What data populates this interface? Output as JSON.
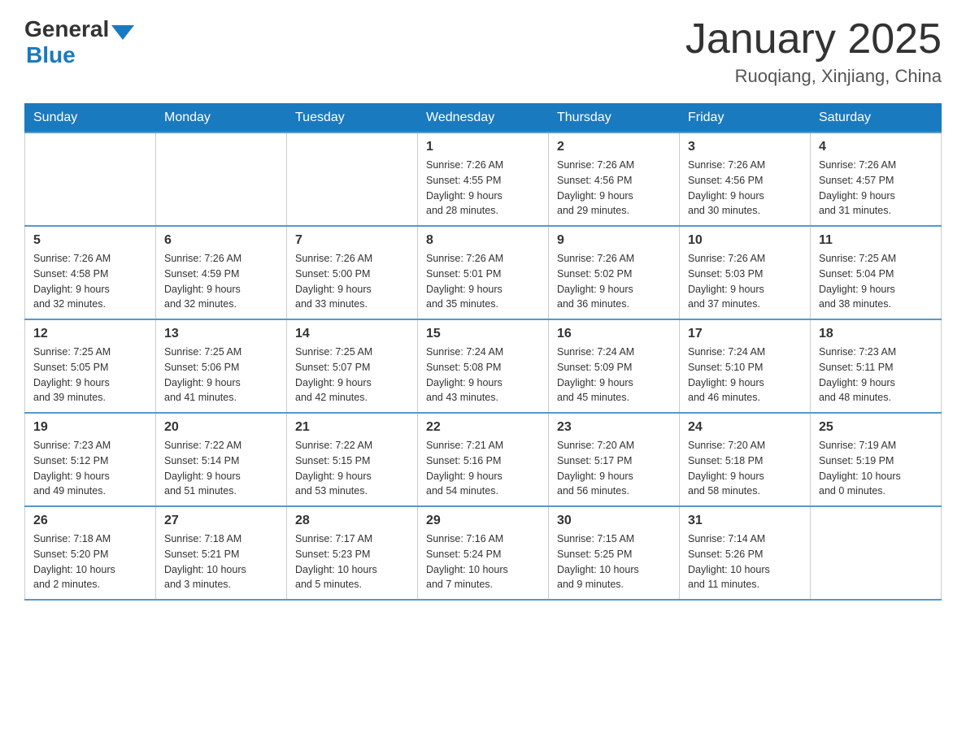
{
  "header": {
    "logo": {
      "general": "General",
      "blue": "Blue"
    },
    "title": "January 2025",
    "location": "Ruoqiang, Xinjiang, China"
  },
  "calendar": {
    "days_of_week": [
      "Sunday",
      "Monday",
      "Tuesday",
      "Wednesday",
      "Thursday",
      "Friday",
      "Saturday"
    ],
    "weeks": [
      [
        {
          "date": "",
          "info": ""
        },
        {
          "date": "",
          "info": ""
        },
        {
          "date": "",
          "info": ""
        },
        {
          "date": "1",
          "info": "Sunrise: 7:26 AM\nSunset: 4:55 PM\nDaylight: 9 hours\nand 28 minutes."
        },
        {
          "date": "2",
          "info": "Sunrise: 7:26 AM\nSunset: 4:56 PM\nDaylight: 9 hours\nand 29 minutes."
        },
        {
          "date": "3",
          "info": "Sunrise: 7:26 AM\nSunset: 4:56 PM\nDaylight: 9 hours\nand 30 minutes."
        },
        {
          "date": "4",
          "info": "Sunrise: 7:26 AM\nSunset: 4:57 PM\nDaylight: 9 hours\nand 31 minutes."
        }
      ],
      [
        {
          "date": "5",
          "info": "Sunrise: 7:26 AM\nSunset: 4:58 PM\nDaylight: 9 hours\nand 32 minutes."
        },
        {
          "date": "6",
          "info": "Sunrise: 7:26 AM\nSunset: 4:59 PM\nDaylight: 9 hours\nand 32 minutes."
        },
        {
          "date": "7",
          "info": "Sunrise: 7:26 AM\nSunset: 5:00 PM\nDaylight: 9 hours\nand 33 minutes."
        },
        {
          "date": "8",
          "info": "Sunrise: 7:26 AM\nSunset: 5:01 PM\nDaylight: 9 hours\nand 35 minutes."
        },
        {
          "date": "9",
          "info": "Sunrise: 7:26 AM\nSunset: 5:02 PM\nDaylight: 9 hours\nand 36 minutes."
        },
        {
          "date": "10",
          "info": "Sunrise: 7:26 AM\nSunset: 5:03 PM\nDaylight: 9 hours\nand 37 minutes."
        },
        {
          "date": "11",
          "info": "Sunrise: 7:25 AM\nSunset: 5:04 PM\nDaylight: 9 hours\nand 38 minutes."
        }
      ],
      [
        {
          "date": "12",
          "info": "Sunrise: 7:25 AM\nSunset: 5:05 PM\nDaylight: 9 hours\nand 39 minutes."
        },
        {
          "date": "13",
          "info": "Sunrise: 7:25 AM\nSunset: 5:06 PM\nDaylight: 9 hours\nand 41 minutes."
        },
        {
          "date": "14",
          "info": "Sunrise: 7:25 AM\nSunset: 5:07 PM\nDaylight: 9 hours\nand 42 minutes."
        },
        {
          "date": "15",
          "info": "Sunrise: 7:24 AM\nSunset: 5:08 PM\nDaylight: 9 hours\nand 43 minutes."
        },
        {
          "date": "16",
          "info": "Sunrise: 7:24 AM\nSunset: 5:09 PM\nDaylight: 9 hours\nand 45 minutes."
        },
        {
          "date": "17",
          "info": "Sunrise: 7:24 AM\nSunset: 5:10 PM\nDaylight: 9 hours\nand 46 minutes."
        },
        {
          "date": "18",
          "info": "Sunrise: 7:23 AM\nSunset: 5:11 PM\nDaylight: 9 hours\nand 48 minutes."
        }
      ],
      [
        {
          "date": "19",
          "info": "Sunrise: 7:23 AM\nSunset: 5:12 PM\nDaylight: 9 hours\nand 49 minutes."
        },
        {
          "date": "20",
          "info": "Sunrise: 7:22 AM\nSunset: 5:14 PM\nDaylight: 9 hours\nand 51 minutes."
        },
        {
          "date": "21",
          "info": "Sunrise: 7:22 AM\nSunset: 5:15 PM\nDaylight: 9 hours\nand 53 minutes."
        },
        {
          "date": "22",
          "info": "Sunrise: 7:21 AM\nSunset: 5:16 PM\nDaylight: 9 hours\nand 54 minutes."
        },
        {
          "date": "23",
          "info": "Sunrise: 7:20 AM\nSunset: 5:17 PM\nDaylight: 9 hours\nand 56 minutes."
        },
        {
          "date": "24",
          "info": "Sunrise: 7:20 AM\nSunset: 5:18 PM\nDaylight: 9 hours\nand 58 minutes."
        },
        {
          "date": "25",
          "info": "Sunrise: 7:19 AM\nSunset: 5:19 PM\nDaylight: 10 hours\nand 0 minutes."
        }
      ],
      [
        {
          "date": "26",
          "info": "Sunrise: 7:18 AM\nSunset: 5:20 PM\nDaylight: 10 hours\nand 2 minutes."
        },
        {
          "date": "27",
          "info": "Sunrise: 7:18 AM\nSunset: 5:21 PM\nDaylight: 10 hours\nand 3 minutes."
        },
        {
          "date": "28",
          "info": "Sunrise: 7:17 AM\nSunset: 5:23 PM\nDaylight: 10 hours\nand 5 minutes."
        },
        {
          "date": "29",
          "info": "Sunrise: 7:16 AM\nSunset: 5:24 PM\nDaylight: 10 hours\nand 7 minutes."
        },
        {
          "date": "30",
          "info": "Sunrise: 7:15 AM\nSunset: 5:25 PM\nDaylight: 10 hours\nand 9 minutes."
        },
        {
          "date": "31",
          "info": "Sunrise: 7:14 AM\nSunset: 5:26 PM\nDaylight: 10 hours\nand 11 minutes."
        },
        {
          "date": "",
          "info": ""
        }
      ]
    ]
  }
}
